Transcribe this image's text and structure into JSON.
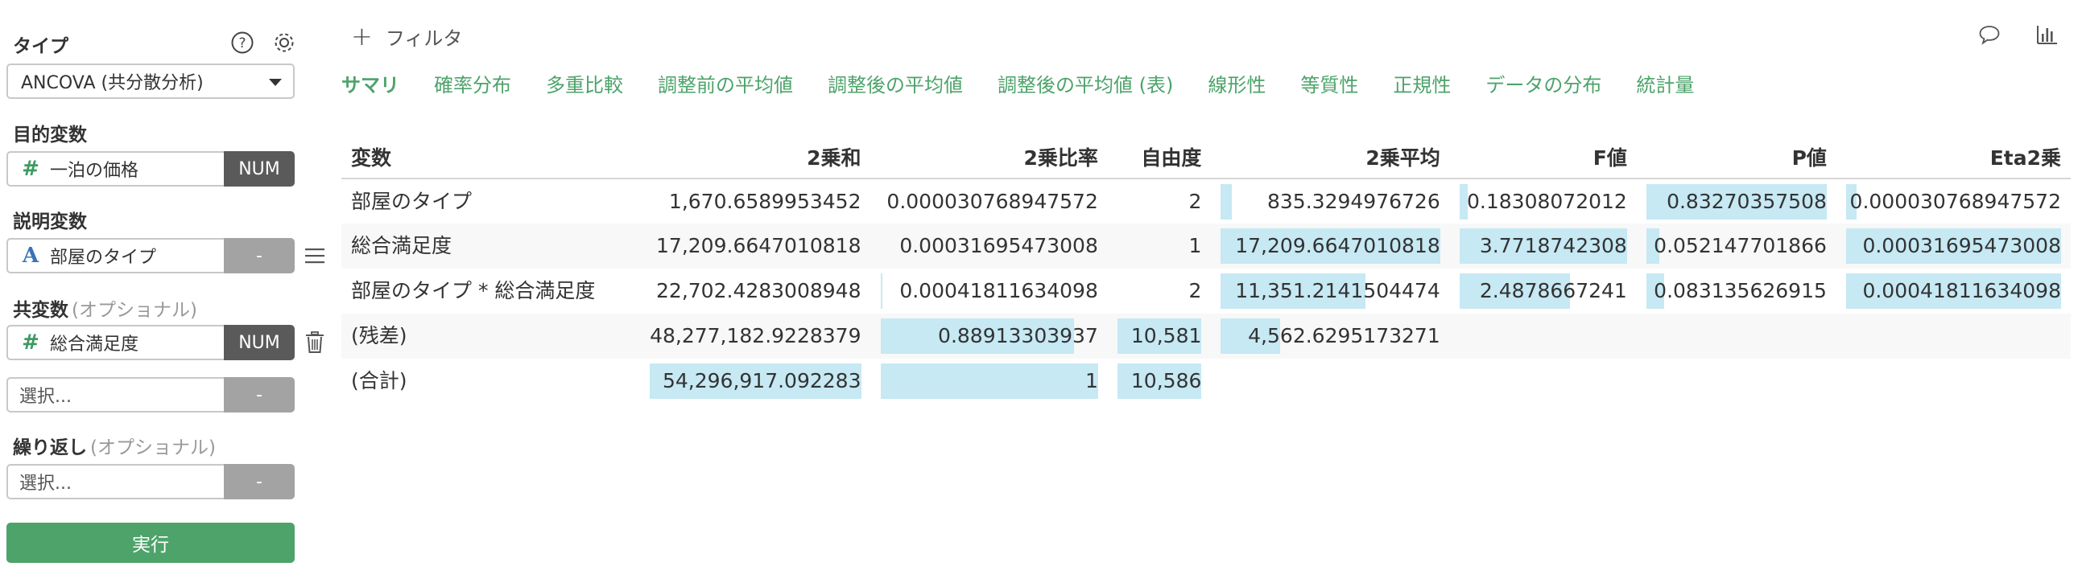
{
  "sidebar": {
    "type_label": "タイプ",
    "type_value": "ANCOVA (共分散分析)",
    "target_label": "目的変数",
    "target": {
      "name": "一泊の価格",
      "badge": "NUM",
      "icon": "#"
    },
    "explanatory_label": "説明変数",
    "explanatory": {
      "name": "部屋のタイプ",
      "badge": "-",
      "icon": "A"
    },
    "covariate_label": "共変数",
    "covariate_optional": "(オプショナル)",
    "covariate": {
      "name": "総合満足度",
      "badge": "NUM",
      "icon": "#"
    },
    "covariate_select": {
      "placeholder": "選択...",
      "badge": "-"
    },
    "repeat_label": "繰り返し",
    "repeat_optional": "(オプショナル)",
    "repeat_select": {
      "placeholder": "選択...",
      "badge": "-"
    },
    "run_label": "実行",
    "icons": [
      "help-icon",
      "gear-icon",
      "menu-icon",
      "trash-icon"
    ]
  },
  "main": {
    "filter_label": "フィルタ",
    "right_icons": [
      "comment-icon",
      "chart-icon"
    ],
    "tabs": [
      {
        "label": "サマリ",
        "active": true
      },
      {
        "label": "確率分布",
        "active": false
      },
      {
        "label": "多重比較",
        "active": false
      },
      {
        "label": "調整前の平均値",
        "active": false
      },
      {
        "label": "調整後の平均値",
        "active": false
      },
      {
        "label": "調整後の平均値 (表)",
        "active": false
      },
      {
        "label": "線形性",
        "active": false
      },
      {
        "label": "等質性",
        "active": false
      },
      {
        "label": "正規性",
        "active": false
      },
      {
        "label": "データの分布",
        "active": false
      },
      {
        "label": "統計量",
        "active": false
      }
    ],
    "table": {
      "headers": [
        "変数",
        "2乗和",
        "2乗比率",
        "自由度",
        "2乗平均",
        "F値",
        "P値",
        "Eta2乗"
      ],
      "rows": [
        {
          "cells": [
            "部屋のタイプ",
            "1,670.6589953452",
            "0.000030768947572",
            "2",
            "835.3294976726",
            "0.18308072012",
            "0.83270357508",
            "0.000030768947572"
          ],
          "fill": [
            null,
            0.0,
            0.0,
            0.0,
            0.05,
            0.05,
            1.0,
            0.05
          ]
        },
        {
          "cells": [
            "総合満足度",
            "17,209.6647010818",
            "0.00031695473008",
            "1",
            "17,209.6647010818",
            "3.7718742308",
            "0.052147701866",
            "0.00031695473008"
          ],
          "fill": [
            null,
            0.0,
            0.0,
            0.0,
            1.0,
            1.0,
            0.07,
            1.0
          ]
        },
        {
          "cells": [
            "部屋のタイプ * 総合満足度",
            "22,702.4283008948",
            "0.00041811634098",
            "2",
            "11,351.2141504474",
            "2.4878667241",
            "0.083135626915",
            "0.00041811634098"
          ],
          "fill": [
            null,
            0.0,
            0.01,
            0.0,
            0.66,
            0.66,
            0.1,
            1.0
          ]
        },
        {
          "cells": [
            "(残差)",
            "48,277,182.9228379",
            "0.88913303937",
            "10,581",
            "4,562.6295173271",
            "",
            "",
            ""
          ],
          "fill": [
            null,
            0.0,
            0.89,
            1.0,
            0.27,
            0,
            0,
            0
          ]
        },
        {
          "cells": [
            "(合計)",
            "54,296,917.092283",
            "1",
            "10,586",
            "",
            "",
            "",
            ""
          ],
          "fill": [
            null,
            1.0,
            1.0,
            1.0,
            0,
            0,
            0,
            0
          ]
        }
      ]
    }
  }
}
